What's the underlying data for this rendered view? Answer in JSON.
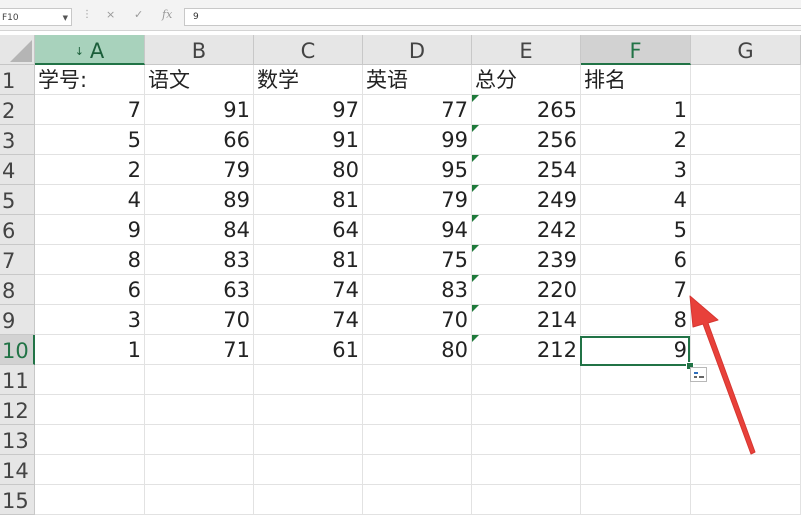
{
  "formula_bar": {
    "name_box": "F10",
    "cancel_icon": "×",
    "enter_icon": "✓",
    "fx_label": "fx",
    "content": "9"
  },
  "columns": [
    "A",
    "B",
    "C",
    "D",
    "E",
    "F",
    "G"
  ],
  "rows": [
    "1",
    "2",
    "3",
    "4",
    "5",
    "6",
    "7",
    "8",
    "9",
    "10",
    "11",
    "12",
    "13",
    "14",
    "15"
  ],
  "headers": [
    "学号:",
    "语文",
    "数学",
    "英语",
    "总分",
    "排名"
  ],
  "data": [
    [
      "7",
      "91",
      "97",
      "77",
      "265",
      "1"
    ],
    [
      "5",
      "66",
      "91",
      "99",
      "256",
      "2"
    ],
    [
      "2",
      "79",
      "80",
      "95",
      "254",
      "3"
    ],
    [
      "4",
      "89",
      "81",
      "79",
      "249",
      "4"
    ],
    [
      "9",
      "84",
      "64",
      "94",
      "242",
      "5"
    ],
    [
      "8",
      "83",
      "81",
      "75",
      "239",
      "6"
    ],
    [
      "6",
      "63",
      "74",
      "83",
      "220",
      "7"
    ],
    [
      "3",
      "70",
      "74",
      "70",
      "214",
      "8"
    ],
    [
      "1",
      "71",
      "61",
      "80",
      "212",
      "9"
    ]
  ],
  "selected_cell": "F10",
  "colors": {
    "accent": "#217346",
    "arrow": "#e8413a",
    "text_number_flag": "#1f7a3a"
  },
  "icons": {
    "sort_indicator": "↓",
    "quick_analysis": "quick-analysis-icon",
    "callout_arrow": "red-arrow"
  }
}
